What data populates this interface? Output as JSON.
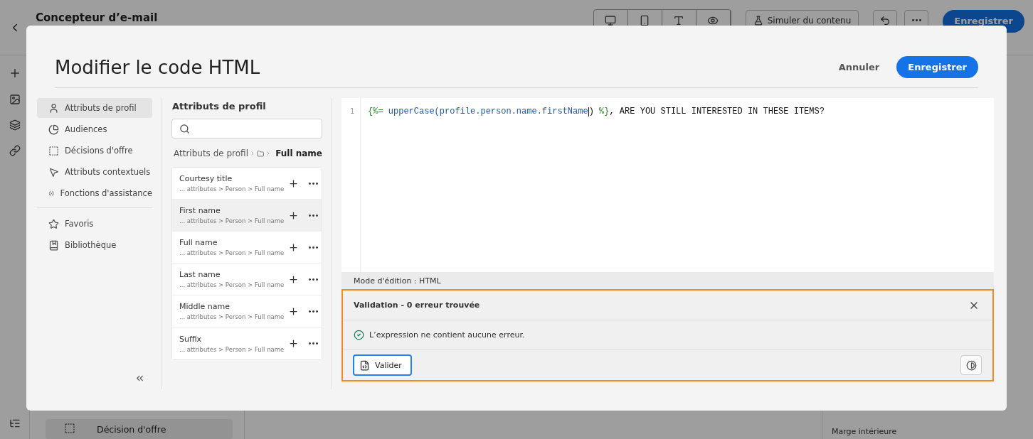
{
  "background": {
    "title": "Concepteur d’e-mail",
    "simulate_button": "Simuler du contenu",
    "save_button": "Enregistrer",
    "offer_card": "Décision d'offre",
    "padding_label": "Marge intérieure"
  },
  "modal": {
    "title": "Modifier le code HTML",
    "cancel": "Annuler",
    "save": "Enregistrer"
  },
  "nav": [
    {
      "kind": "item",
      "label": "Attributs de profil",
      "selected": true
    },
    {
      "kind": "item",
      "label": "Audiences",
      "selected": false
    },
    {
      "kind": "item",
      "label": "Décisions d'offre",
      "selected": false
    },
    {
      "kind": "item",
      "label": "Attributs contextuels",
      "selected": false
    },
    {
      "kind": "item",
      "label": "Fonctions d'assistance",
      "selected": false
    },
    {
      "kind": "divider"
    },
    {
      "kind": "item",
      "label": "Favoris",
      "selected": false
    },
    {
      "kind": "item",
      "label": "Bibliothèque",
      "selected": false
    }
  ],
  "attributes": {
    "heading": "Attributs de profil",
    "breadcrumb_root": "Attributs de profil",
    "breadcrumb_current": "Full name",
    "items": [
      {
        "name": "Courtesy title",
        "path": "... attributes > Person > Full name",
        "hovered": false
      },
      {
        "name": "First name",
        "path": "... attributes > Person > Full name",
        "hovered": true
      },
      {
        "name": "Full name",
        "path": "... attributes > Person > Full name",
        "hovered": false
      },
      {
        "name": "Last name",
        "path": "... attributes > Person > Full name",
        "hovered": false
      },
      {
        "name": "Middle name",
        "path": "... attributes > Person > Full name",
        "hovered": false
      },
      {
        "name": "Suffix",
        "path": "... attributes > Person > Full name",
        "hovered": false
      }
    ]
  },
  "editor": {
    "line_number": "1",
    "tokens": [
      {
        "kind": "tag",
        "text": "{%="
      },
      {
        "kind": "ident",
        "text": " upperCase(profile.person.name.firstName"
      },
      {
        "kind": "caret"
      },
      {
        "kind": "text",
        "text": ")"
      },
      {
        "kind": "tag",
        "text": " %}"
      },
      {
        "kind": "text",
        "text": ", ARE YOU STILL INTERESTED IN THESE ITEMS?"
      }
    ],
    "mode": "Mode d'édition : HTML"
  },
  "validation": {
    "title": "Validation - 0 erreur trouvée",
    "message": "L’expression ne contient aucune erreur.",
    "validate_button": "Valider"
  }
}
